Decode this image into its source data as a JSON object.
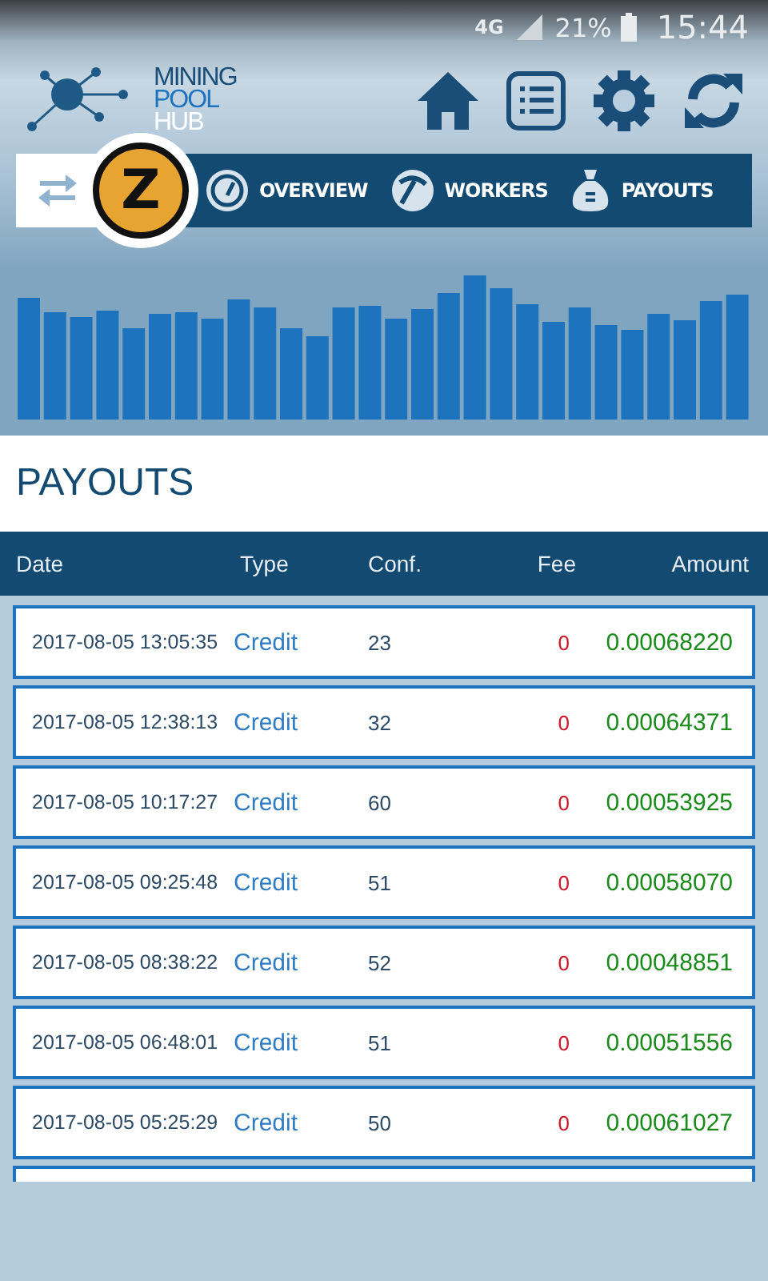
{
  "status_bar": {
    "network": "4G",
    "battery": "21%",
    "time": "15:44"
  },
  "logo": {
    "lines": [
      "MINING",
      "POOL",
      "HUB"
    ]
  },
  "coin": {
    "symbol": "Z"
  },
  "nav": [
    {
      "label": "OVERVIEW",
      "kind": "gauge"
    },
    {
      "label": "WORKERS",
      "kind": "pickaxe"
    },
    {
      "label": "PAYOUTS",
      "kind": "moneybag"
    }
  ],
  "section_title": "PAYOUTS",
  "table": {
    "columns": [
      "Date",
      "Type",
      "Conf.",
      "Fee",
      "Amount"
    ],
    "rows": [
      {
        "date": "2017-08-05 13:05:35",
        "type": "Credit",
        "conf": "23",
        "fee": "0",
        "amount": "0.00068220"
      },
      {
        "date": "2017-08-05 12:38:13",
        "type": "Credit",
        "conf": "32",
        "fee": "0",
        "amount": "0.00064371"
      },
      {
        "date": "2017-08-05 10:17:27",
        "type": "Credit",
        "conf": "60",
        "fee": "0",
        "amount": "0.00053925"
      },
      {
        "date": "2017-08-05 09:25:48",
        "type": "Credit",
        "conf": "51",
        "fee": "0",
        "amount": "0.00058070"
      },
      {
        "date": "2017-08-05 08:38:22",
        "type": "Credit",
        "conf": "52",
        "fee": "0",
        "amount": "0.00048851"
      },
      {
        "date": "2017-08-05 06:48:01",
        "type": "Credit",
        "conf": "51",
        "fee": "0",
        "amount": "0.00051556"
      },
      {
        "date": "2017-08-05 05:25:29",
        "type": "Credit",
        "conf": "50",
        "fee": "0",
        "amount": "0.00061027"
      }
    ]
  }
}
